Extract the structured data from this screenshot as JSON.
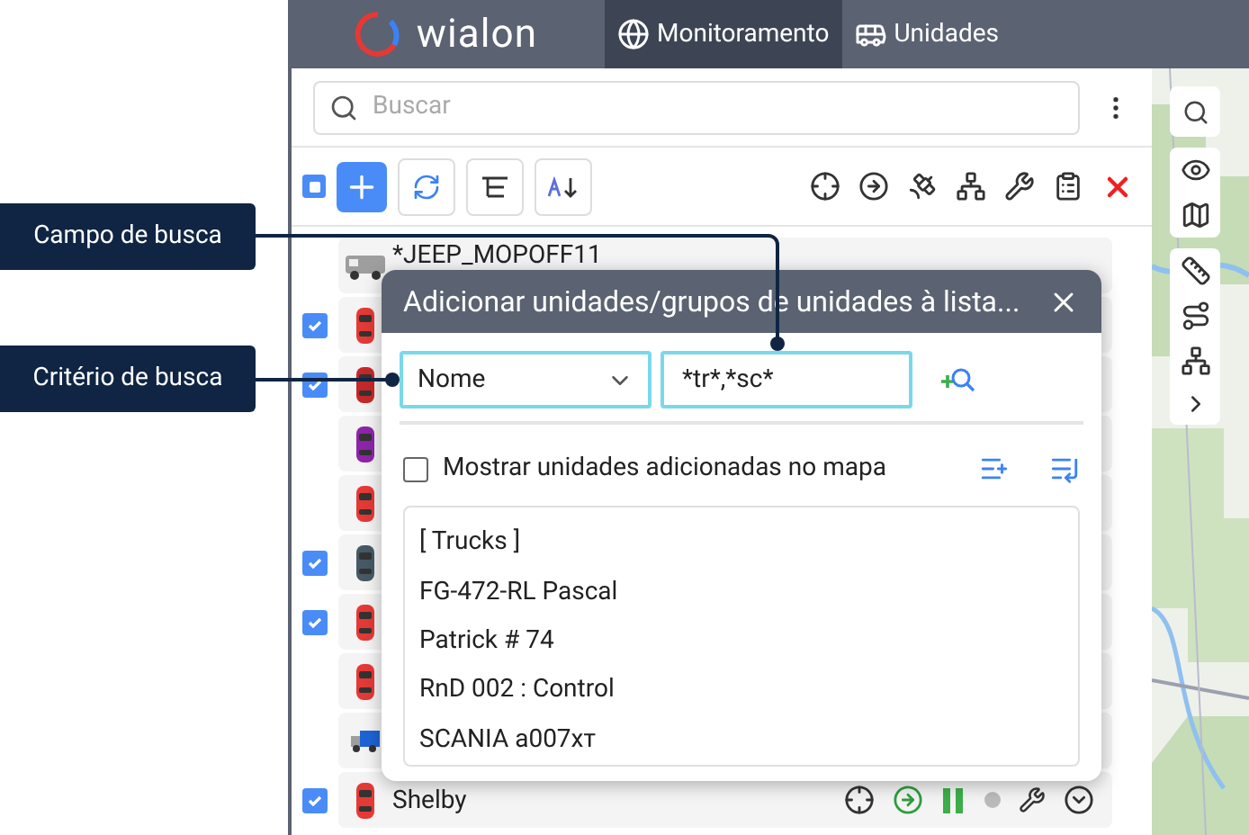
{
  "callouts": [
    {
      "label": "Campo de busca"
    },
    {
      "label": "Critério de busca"
    }
  ],
  "header": {
    "logo": "wialon",
    "tabs": [
      {
        "label": "Monitoramento",
        "selected": true,
        "kind": "globe"
      },
      {
        "label": "Unidades",
        "selected": false,
        "kind": "bus"
      }
    ]
  },
  "search": {
    "placeholder": "Buscar"
  },
  "select_all": {
    "checked": true
  },
  "units": [
    {
      "kind": "van",
      "checked": false,
      "name": "*JEEP_MOPOFF11",
      "color": "#9e9e9e"
    },
    {
      "kind": "car",
      "checked": true,
      "color": "#e53935"
    },
    {
      "kind": "car",
      "checked": true,
      "color": "#c62828"
    },
    {
      "kind": "car",
      "checked": false,
      "color": "#8e24aa"
    },
    {
      "kind": "car",
      "checked": false,
      "color": "#e53935"
    },
    {
      "kind": "car",
      "checked": true,
      "color": "#455a64"
    },
    {
      "kind": "car",
      "checked": true,
      "color": "#e53935"
    },
    {
      "kind": "car",
      "checked": false,
      "color": "#e53935"
    },
    {
      "kind": "truck",
      "checked": false,
      "color": "#1e63d6"
    },
    {
      "kind": "car",
      "checked": true,
      "name": "Shelby",
      "color": "#e53935"
    }
  ],
  "dialog": {
    "title": "Adicionar unidades/grupos de unidades à lista...",
    "criterion": "Nome",
    "query": "*tr*,*sc*",
    "show_on_map": {
      "label": "Mostrar unidades adicionadas no mapa",
      "checked": false
    },
    "results": [
      "[ Trucks ]",
      "FG-472-RL Pascal",
      "Patrick # 74",
      "RnD 002 : Control",
      "SCANIA a007xт"
    ]
  }
}
